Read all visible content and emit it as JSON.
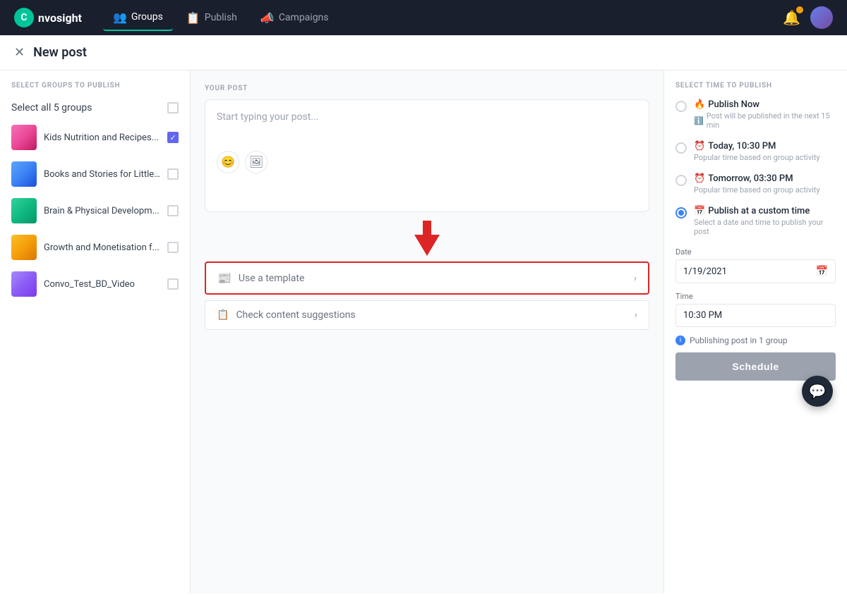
{
  "nav": {
    "logo_text": "c nvosight",
    "logo_initial": "C",
    "items": [
      {
        "id": "groups",
        "label": "Groups",
        "icon": "👥",
        "active": true
      },
      {
        "id": "publish",
        "label": "Publish",
        "icon": "📋",
        "active": false
      },
      {
        "id": "campaigns",
        "label": "Campaigns",
        "icon": "📣",
        "active": false
      }
    ]
  },
  "page": {
    "title": "New post",
    "close_label": "×"
  },
  "left_panel": {
    "section_label": "SELECT GROUPS TO PUBLISH",
    "select_all_label": "Select all 5 groups",
    "groups": [
      {
        "id": 1,
        "name": "Kids Nutrition and Recipes...",
        "checked": true
      },
      {
        "id": 2,
        "name": "Books and Stories for Little...",
        "checked": false
      },
      {
        "id": 3,
        "name": "Brain & Physical Developm...",
        "checked": false
      },
      {
        "id": 4,
        "name": "Growth and Monetisation f...",
        "checked": false
      },
      {
        "id": 5,
        "name": "Convo_Test_BD_Video",
        "checked": false
      }
    ]
  },
  "middle_panel": {
    "section_label": "YOUR POST",
    "placeholder": "Start typing your post...",
    "template_row_label": "Use a template",
    "suggestions_row_label": "Check content suggestions"
  },
  "right_panel": {
    "section_label": "SELECT TIME TO PUBLISH",
    "options": [
      {
        "id": "now",
        "emoji": "🔥",
        "title": "Publish Now",
        "subtitle": "Post will be published in the next 15 min",
        "subtitle_icon": "ℹ",
        "selected": false
      },
      {
        "id": "today",
        "emoji": "⏰",
        "title": "Today, 10:30 PM",
        "subtitle": "Popular time based on group activity",
        "selected": false
      },
      {
        "id": "tomorrow",
        "emoji": "⏰",
        "title": "Tomorrow, 03:30 PM",
        "subtitle": "Popular time based on group activity",
        "selected": false
      },
      {
        "id": "custom",
        "emoji": "📅",
        "title": "Publish at a custom time",
        "subtitle": "Select a date and time to publish your post",
        "selected": true
      }
    ],
    "date_label": "Date",
    "date_value": "1/19/2021",
    "time_label": "Time",
    "time_value": "10:30 PM",
    "publish_info": "Publishing post in 1 group",
    "schedule_btn": "Schedule"
  }
}
